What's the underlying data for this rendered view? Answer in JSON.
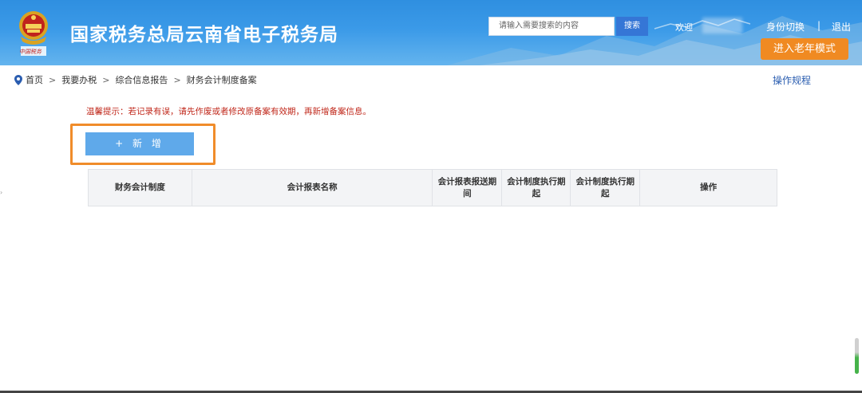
{
  "header": {
    "site_title": "国家税务总局云南省电子税务局",
    "emblem_caption": "中国税务",
    "search_placeholder": "请输入需要搜索的内容",
    "search_button": "搜索",
    "welcome_label": "欢迎",
    "role_switch": "身份切换",
    "divider": "|",
    "logout": "退出",
    "elder_mode_button": "进入老年模式",
    "colors": {
      "banner": "#3b9ae8",
      "elder_button": "#f08a22",
      "search_button": "#3576d6"
    }
  },
  "breadcrumb": {
    "icon": "location-pin-icon",
    "separator": ">",
    "items": [
      "首页",
      "我要办税",
      "综合信息报告",
      "财务会计制度备案"
    ]
  },
  "operation_guide": "操作规程",
  "tip_text": "温馨提示：若记录有误，请先作废或者修改原备案有效期，再新增备案信息。",
  "add_button": {
    "label": "+ 新 增",
    "color": "#5fa9ea",
    "highlight_color": "#f08c2a"
  },
  "table": {
    "columns": [
      "财务会计制度",
      "会计报表名称",
      "会计报表报送期间",
      "会计制度执行期起",
      "会计制度执行期起",
      "操作"
    ]
  },
  "side_marker": "›"
}
